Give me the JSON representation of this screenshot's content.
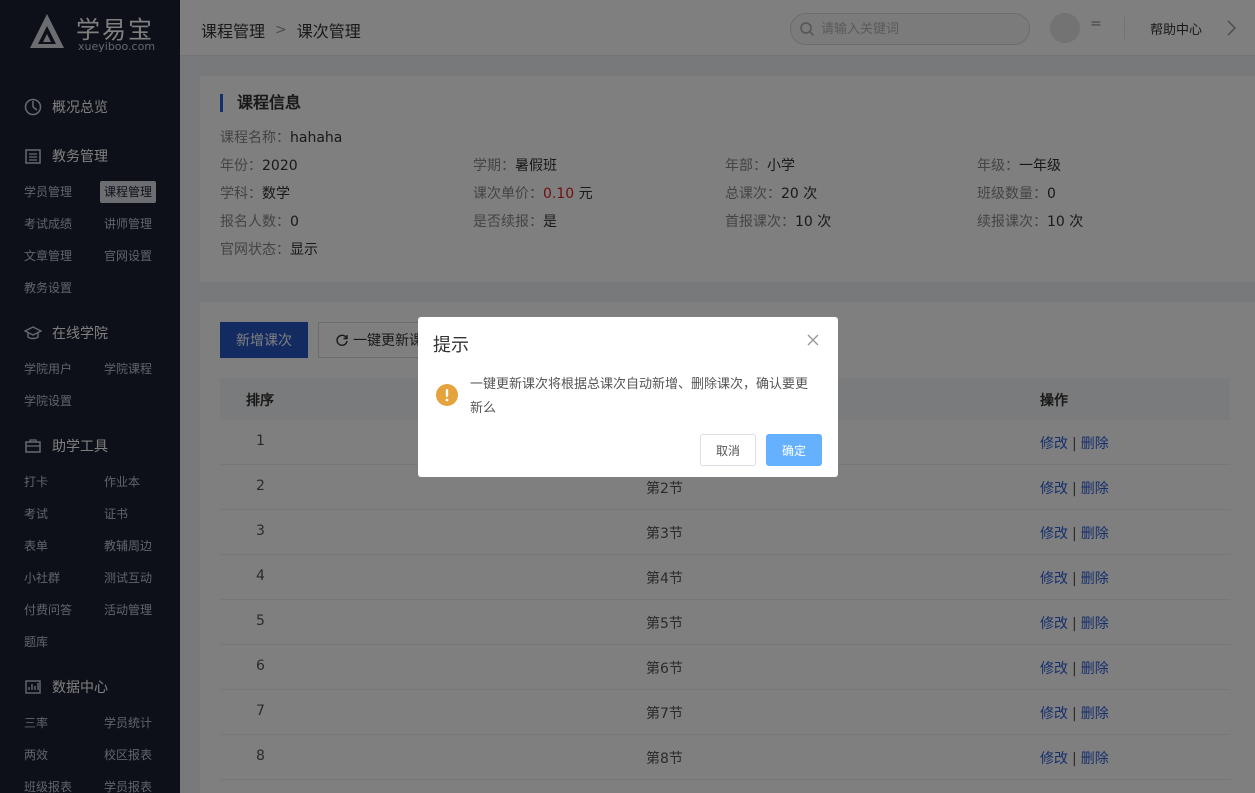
{
  "brand": {
    "name": "学易宝",
    "domain": "xueyiboo.com"
  },
  "sidebar": {
    "groups": [
      {
        "label": "概况总览",
        "icon": "dashboard-icon",
        "items": []
      },
      {
        "label": "教务管理",
        "icon": "building-icon",
        "items": [
          "学员管理",
          "课程管理",
          "考试成绩",
          "讲师管理",
          "文章管理",
          "官网设置",
          "教务设置"
        ]
      },
      {
        "label": "在线学院",
        "icon": "graduation-cap-icon",
        "items": [
          "学院用户",
          "学院课程",
          "学院设置"
        ]
      },
      {
        "label": "助学工具",
        "icon": "briefcase-icon",
        "items": [
          "打卡",
          "作业本",
          "考试",
          "证书",
          "表单",
          "教辅周边",
          "小社群",
          "测试互动",
          "付费问答",
          "活动管理",
          "题库"
        ]
      },
      {
        "label": "数据中心",
        "icon": "chart-icon",
        "items": [
          "三率",
          "学员统计",
          "两效",
          "校区报表",
          "班级报表",
          "学员报表"
        ]
      }
    ],
    "active_item": "课程管理"
  },
  "header": {
    "breadcrumb": [
      "课程管理",
      "课次管理"
    ],
    "search_placeholder": "请输入关键词",
    "menu_glyph": "=",
    "help_label": "帮助中心"
  },
  "course_info": {
    "title": "课程信息",
    "name_label": "课程名称：",
    "name": "hahaha",
    "year_label": "年份：",
    "year": "2020",
    "term_label": "学期：",
    "term": "暑假班",
    "dept_label": "年部：",
    "dept": "小学",
    "grade_label": "年级：",
    "grade": "一年级",
    "subject_label": "学科：",
    "subject": "数学",
    "unit_price_label": "课次单价：",
    "unit_price": "0.10",
    "unit_price_suffix": " 元",
    "total_lessons_label": "总课次：",
    "total_lessons": "20 次",
    "class_count_label": "班级数量：",
    "class_count": "0",
    "enroll_label": "报名人数：",
    "enroll": "0",
    "renew_label": "是否续报：",
    "renew": "是",
    "first_lessons_label": "首报课次：",
    "first_lessons": "10 次",
    "renew_lessons_label": "续报课次：",
    "renew_lessons": "10 次",
    "site_status_label": "官网状态：",
    "site_status": "显示"
  },
  "toolbar": {
    "add_label": "新增课次",
    "update_label": "一键更新课"
  },
  "table": {
    "headers": {
      "order": "排序",
      "ops": "操作"
    },
    "rows": [
      {
        "order": "1",
        "name": ""
      },
      {
        "order": "2",
        "name": "第2节"
      },
      {
        "order": "3",
        "name": "第3节"
      },
      {
        "order": "4",
        "name": "第4节"
      },
      {
        "order": "5",
        "name": "第5节"
      },
      {
        "order": "6",
        "name": "第6节"
      },
      {
        "order": "7",
        "name": "第7节"
      },
      {
        "order": "8",
        "name": "第8节"
      }
    ],
    "edit_label": "修改",
    "delete_label": "删除"
  },
  "dialog": {
    "title": "提示",
    "message": "一键更新课次将根据总课次自动新增、删除课次，确认要更新么",
    "cancel_label": "取消",
    "ok_label": "确定"
  },
  "colors": {
    "sidebar_bg": "#1b2133",
    "primary": "#2656c2",
    "link": "#2b5fd9",
    "price": "#e02020",
    "warn": "#e6a23c",
    "ok_button": "#66b1ff"
  }
}
